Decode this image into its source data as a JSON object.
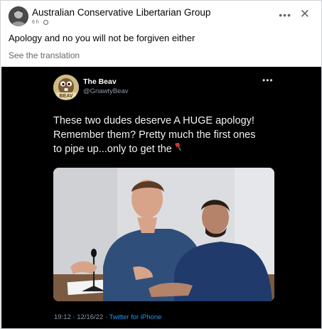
{
  "post": {
    "group_name": "Australian Conservative Libertarian Group",
    "time": "6 h",
    "separator": "·",
    "text": "Apology and no you will not be forgiven either",
    "translation_link": "See the translation"
  },
  "icons": {
    "more": "more-horizontal-icon",
    "close": "close-icon",
    "audience": "globe-icon",
    "emoji": "axe-emoji-icon"
  },
  "tweet": {
    "author_name": "The Beav",
    "author_handle": "@GnawtyBeav",
    "body_lines": [
      "These two dudes deserve A HUGE apology!",
      "Remember them? Pretty much the first ones",
      "to pipe up...only to get the"
    ],
    "timestamp": "19:12 · 12/16/22 · ",
    "source": "Twitter for iPhone",
    "avatar_badge": "BEAV"
  },
  "colors": {
    "tweet_background": "#000000",
    "link_blue": "#1d9bf0",
    "muted_gray": "#65676b"
  }
}
